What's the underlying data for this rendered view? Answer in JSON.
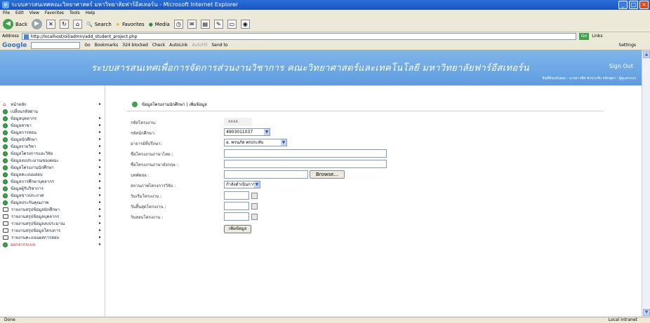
{
  "window": {
    "title": "ระบบสารสนเทศคณะวิทยาศาสตร์ มหาวิทยาลัยฟาร์อีสเทอร์น - Microsoft Internet Explorer",
    "controls": [
      "_",
      "□",
      "×"
    ]
  },
  "menu": [
    "File",
    "Edit",
    "View",
    "Favorites",
    "Tools",
    "Help"
  ],
  "toolbar": {
    "back": "Back",
    "search": "Search",
    "favorites": "Favorites",
    "media": "Media"
  },
  "address": {
    "label": "Address",
    "url": "http://localhost/oil/admin/add_student_project.php",
    "go": "Go",
    "links": "Links"
  },
  "google": {
    "logo": "Google",
    "go": "Go",
    "bookmarks": "Bookmarks",
    "blocked": "324 blocked",
    "check": "Check",
    "autolink": "AutoLink",
    "autofill": "AutoFill",
    "sendto": "Send to",
    "settings": "Settings"
  },
  "banner": {
    "title": "ระบบสารสนเทศเพื่อการจัดการส่วนงานวิชาการ คณะวิทยาศาสตร์และเทคโนโลยี มหาวิทยาลัยฟาร์อีสเทอร์น",
    "signout": "Sign Out",
    "user": "ยินดีต้อนรับคุณ : นางสาวพิศ พรประทับ หลักสูตร : ผู้ดูแลระบบ"
  },
  "sidebar": {
    "items": [
      {
        "label": "หน้าหลัก",
        "icon": "home-icon",
        "arrow": "▸"
      },
      {
        "label": "เปลี่ยนรหัสผ่าน",
        "icon": "dot-icon",
        "arrow": ""
      },
      {
        "label": "ข้อมูลบุคลากร",
        "icon": "dot-icon",
        "arrow": "▸"
      },
      {
        "label": "ข้อมูลสาขา",
        "icon": "dot-icon",
        "arrow": "▸"
      },
      {
        "label": "ข้อมูลการสอน",
        "icon": "dot-icon",
        "arrow": "▸"
      },
      {
        "label": "ข้อมูลนักศึกษา",
        "icon": "dot-icon",
        "arrow": "▸"
      },
      {
        "label": "ข้อมูลรายวิชา",
        "icon": "dot-icon",
        "arrow": "▸"
      },
      {
        "label": "ข้อมูลโครงการและวิจัย",
        "icon": "dot-icon",
        "arrow": "▸"
      },
      {
        "label": "ข้อมูลงบประมาณของคณะ",
        "icon": "dot-icon",
        "arrow": "▸"
      },
      {
        "label": "ข้อมูลโครงงานนักศึกษา",
        "icon": "dot-icon",
        "arrow": "▸"
      },
      {
        "label": "ข้อมูลคะแนนสอบ",
        "icon": "dot-icon",
        "arrow": "▸"
      },
      {
        "label": "ข้อมูลการศึกษาบุคลากร",
        "icon": "dot-icon",
        "arrow": "▸"
      },
      {
        "label": "ข้อมูลผู้รับวิชาการ",
        "icon": "dot-icon",
        "arrow": "▸"
      },
      {
        "label": "ข้อมูลข่าวประกาศ",
        "icon": "dot-icon",
        "arrow": "▸"
      },
      {
        "label": "ข้อมูลประกันคุณภาพ",
        "icon": "dot-icon",
        "arrow": "▸"
      },
      {
        "label": "รายงานสรุปข้อมูลนักศึกษา",
        "icon": "book-icon",
        "arrow": "▸"
      },
      {
        "label": "รายงานสรุปข้อมูลบุคลากร",
        "icon": "book-icon",
        "arrow": "▸"
      },
      {
        "label": "รายงานสรุปข้อมูลงบประมาณ",
        "icon": "book-icon",
        "arrow": "▸"
      },
      {
        "label": "รายงานสรุปข้อมูลโครงการ",
        "icon": "book-icon",
        "arrow": "▸"
      },
      {
        "label": "รายงานคะแนนผลการสอบ",
        "icon": "book-icon",
        "arrow": "▸"
      },
      {
        "label": "ออกจากระบบ",
        "icon": "dot-icon",
        "arrow": "▸"
      }
    ]
  },
  "content": {
    "breadcrumb": "ข้อมูลโครงงานนักศึกษา | เพิ่มข้อมูล",
    "form": {
      "project_id_label": "รหัสโครงงาน:",
      "project_id_value": "xxxx",
      "student_id_label": "รหัสนักศึกษา:",
      "student_id_value": "4903011037",
      "advisor_label": "อาจารย์ที่ปรึกษา:",
      "advisor_value": "อ. พรนภัส พรประทับ",
      "name_th_label": "ชื่อโครงงานภาษาไทย :",
      "name_en_label": "ชื่อโครงงานภาษาอังกฤษ :",
      "abstract_label": "บทคัดย่อ :",
      "browse": "Browse...",
      "status_label": "สถานภาพโครงการวิจัย :",
      "status_value": "กำลังดำเนินการ",
      "start_label": "วันเริ่มโครงงาน :",
      "end_label": "วันสิ้นสุดโครงงาน :",
      "exam_label": "วันสอบโครงงาน :",
      "submit": "เพิ่มข้อมูล"
    }
  },
  "status": {
    "left": "Done",
    "right": "Local intranet"
  }
}
